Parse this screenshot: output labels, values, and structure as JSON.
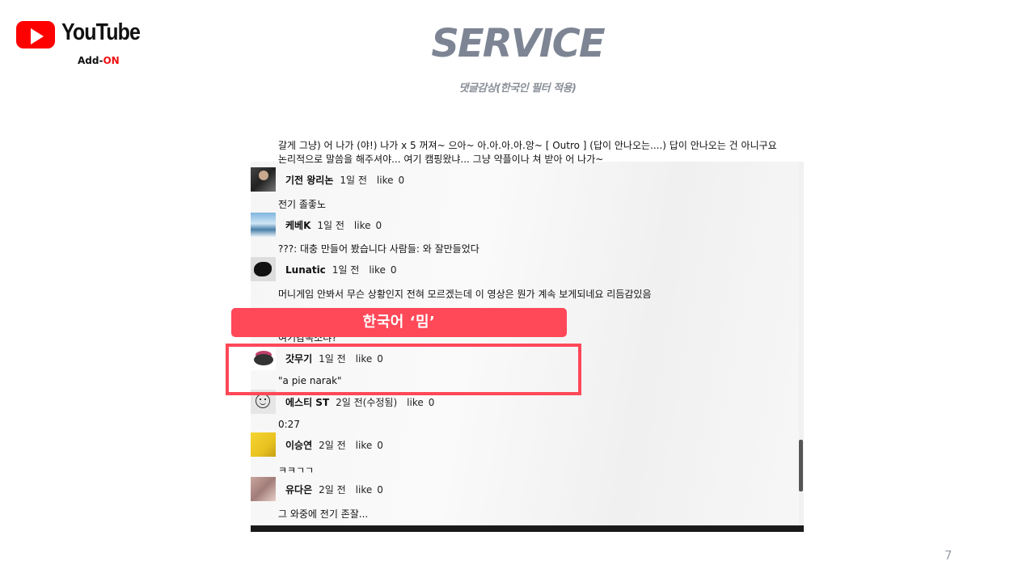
{
  "logo": {
    "brand": "YouTube",
    "addon_prefix": "Add-",
    "addon_suffix": "ON"
  },
  "header": {
    "title": "SERVICE",
    "subtitle": "댓글감상(한국인  필터 적용)"
  },
  "intro_text": "갈게 그냥) 어 나가 (야!) 나가 x 5 꺼져~ 으아~ 아.아.아.아.앙~ [ Outro ] (답이 안나오는....) 답이 안나오는 건 아니구요 논리적으로 말씀을 해주셔야... 여기 캠핑왔냐... 그냥 약플이나 쳐 받아 어 나가~",
  "like_label": "like",
  "comments": [
    {
      "author": "기전 왕리논",
      "time": "1일 전",
      "likes": "0",
      "text": "전기 졸좋노",
      "avatar": "person-avatar"
    },
    {
      "author": "케베K",
      "time": "1일 전",
      "likes": "0",
      "text": "???: 대충 만들어 봤습니다 사람들: 와 잘만들었다",
      "avatar": "landscape-avatar"
    },
    {
      "author": "Lunatic",
      "time": "1일 전",
      "likes": "0",
      "text": "머니게임 안봐서 무슨 상황인지 전혀 모르겠는데 이 영상은 뭔가 계속 보게되네요 리듬감있음",
      "avatar": "black-blob-avatar"
    },
    {
      "author": "",
      "time": "",
      "likes": "",
      "text": "여기감옥소냐?",
      "avatar": ""
    },
    {
      "author": "갓무기",
      "time": "1일 전",
      "likes": "0",
      "text": "\"a pie narak\"",
      "avatar": "crown-avatar"
    },
    {
      "author": "에스티 ST",
      "time": "2일 전(수정됨)",
      "likes": "0",
      "text": "0:27",
      "avatar": "smiley-icon"
    },
    {
      "author": "이승연",
      "time": "2일 전",
      "likes": "0",
      "text": "ㅋㅋㄱㄱ",
      "avatar": "pikachu-avatar"
    },
    {
      "author": "유다은",
      "time": "2일 전",
      "likes": "0",
      "text": "그 와중에 전기 존잘...",
      "avatar": "photo-avatar"
    }
  ],
  "badge": {
    "label": "한국어 ‘밈’"
  },
  "page_number": "7",
  "colors": {
    "accent": "#ff4858",
    "title": "#7d8594",
    "logo_red": "#ff0000"
  }
}
